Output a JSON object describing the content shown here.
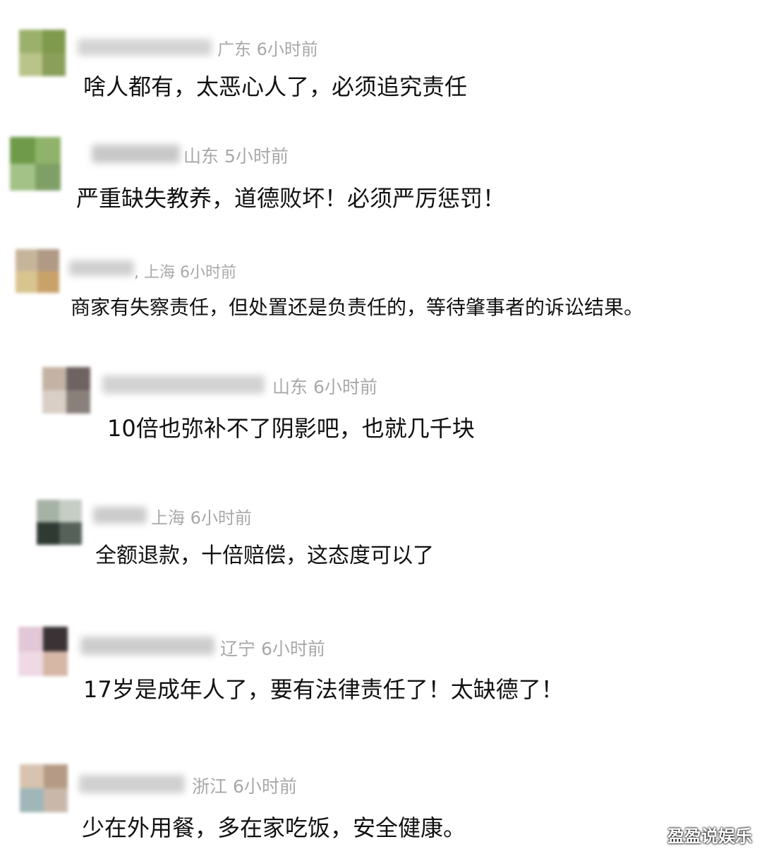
{
  "comments": [
    {
      "location": "广东",
      "time": "6小时前",
      "text": "啥人都有，太恶心人了，必须追究责任"
    },
    {
      "location": "山东",
      "time": "5小时前",
      "text": "严重缺失教养，道德败坏！必须严厉惩罚！"
    },
    {
      "location": "上海",
      "time": "6小时前",
      "text": "商家有失察责任，但处置还是负责任的，等待肇事者的诉讼结果。"
    },
    {
      "location": "山东",
      "time": "6小时前",
      "text": "10倍也弥补不了阴影吧，也就几千块"
    },
    {
      "location": "上海",
      "time": "6小时前",
      "text": "全额退款，十倍赔偿，这态度可以了"
    },
    {
      "location": "辽宁",
      "time": "6小时前",
      "text": "17岁是成年人了，要有法律责任了！太缺德了！"
    },
    {
      "location": "浙江",
      "time": "6小时前",
      "text": "少在外用餐，多在家吃饭，安全健康。"
    }
  ],
  "watermark": "盈盈说娱乐",
  "colors": {
    "meta": "#a8a8a8",
    "text": "#111111",
    "background": "#ffffff"
  }
}
